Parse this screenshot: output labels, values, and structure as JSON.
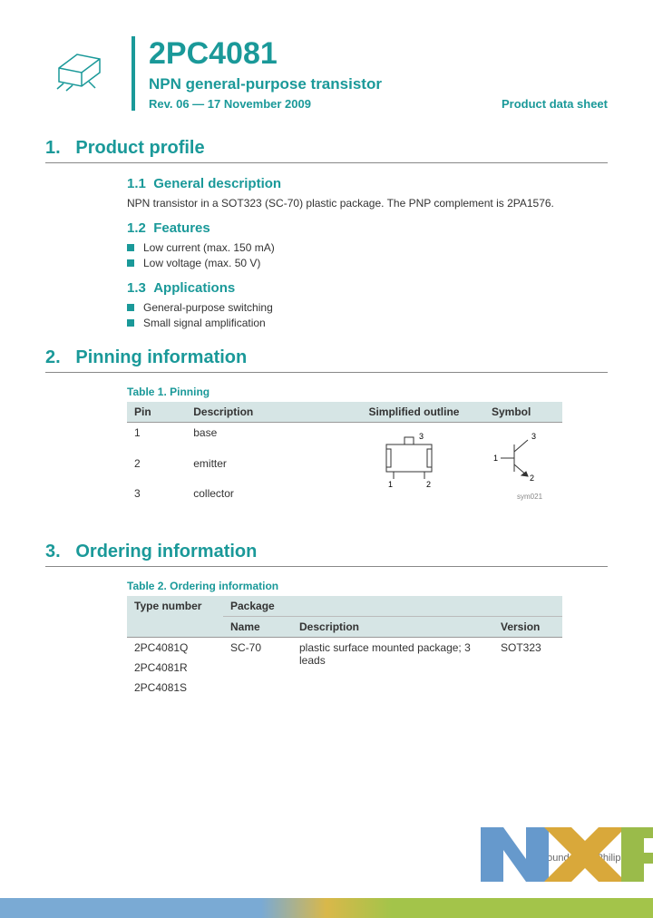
{
  "header": {
    "title": "2PC4081",
    "subtitle": "NPN general-purpose transistor",
    "revision": "Rev. 06 — 17 November 2009",
    "doctype": "Product data sheet"
  },
  "sections": {
    "s1": {
      "num": "1.",
      "title": "Product profile"
    },
    "s1_1": {
      "num": "1.1",
      "title": "General description"
    },
    "s1_1_text": "NPN transistor in a SOT323 (SC-70) plastic package. The PNP complement is 2PA1576.",
    "s1_2": {
      "num": "1.2",
      "title": "Features"
    },
    "features": [
      "Low current (max. 150 mA)",
      "Low voltage (max. 50 V)"
    ],
    "s1_3": {
      "num": "1.3",
      "title": "Applications"
    },
    "applications": [
      "General-purpose switching",
      "Small signal amplification"
    ],
    "s2": {
      "num": "2.",
      "title": "Pinning information"
    },
    "s3": {
      "num": "3.",
      "title": "Ordering information"
    }
  },
  "table1": {
    "caption": "Table 1.    Pinning",
    "headers": {
      "pin": "Pin",
      "desc": "Description",
      "outline": "Simplified outline",
      "sym": "Symbol"
    },
    "rows": [
      {
        "pin": "1",
        "desc": "base"
      },
      {
        "pin": "2",
        "desc": "emitter"
      },
      {
        "pin": "3",
        "desc": "collector"
      }
    ],
    "diagram_labels": {
      "p1": "1",
      "p2": "2",
      "p3": "3"
    },
    "symbol_labels": {
      "p1": "1",
      "p2": "2",
      "p3": "3",
      "ref": "sym021"
    }
  },
  "table2": {
    "caption": "Table 2.    Ordering information",
    "headers": {
      "type": "Type number",
      "pkg": "Package",
      "name": "Name",
      "desc": "Description",
      "ver": "Version"
    },
    "rows": {
      "types": [
        "2PC4081Q",
        "2PC4081R",
        "2PC4081S"
      ],
      "name": "SC-70",
      "desc": "plastic surface mounted package; 3 leads",
      "ver": "SOT323"
    }
  },
  "logo": {
    "tagline": "founded by Philips"
  }
}
